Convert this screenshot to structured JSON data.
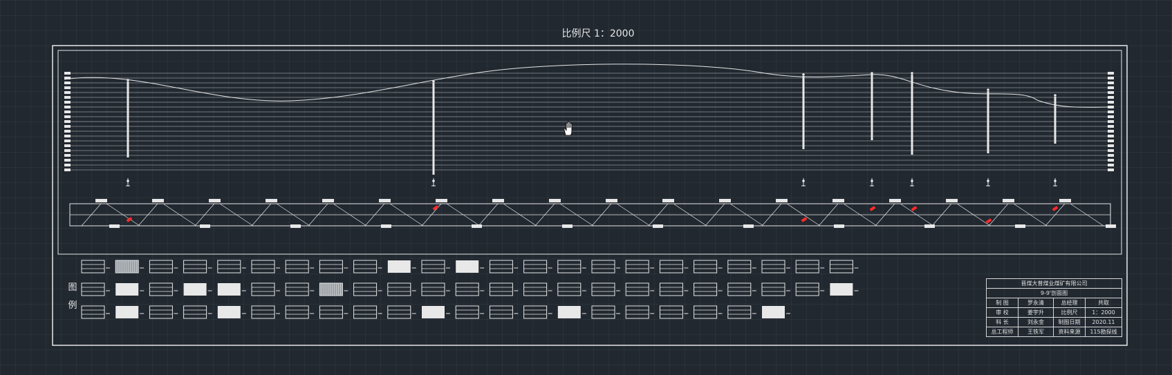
{
  "header": {
    "title": "比例尺 1：2000"
  },
  "legend": {
    "label_chars": [
      "图",
      "例"
    ]
  },
  "title_block": {
    "company": "晋煤大普煤业煤矿有限公司",
    "drawing_name": "9-9'剖面图",
    "rows": [
      [
        "制 图",
        "罗永清",
        "总经理",
        "共取"
      ],
      [
        "审 校",
        "姜宇升",
        "比例尺",
        "1：2000"
      ],
      [
        "科 长",
        "刘永金",
        "制图日期",
        "2020.11"
      ],
      [
        "总工程师",
        "王铁军",
        "资料来源",
        "115勘探线"
      ]
    ]
  },
  "colors": {
    "background": "#212830",
    "line": "#e8e8e8",
    "highlight": "#ff2a2a"
  },
  "icons": {
    "cursor": "hand-pan-icon"
  }
}
